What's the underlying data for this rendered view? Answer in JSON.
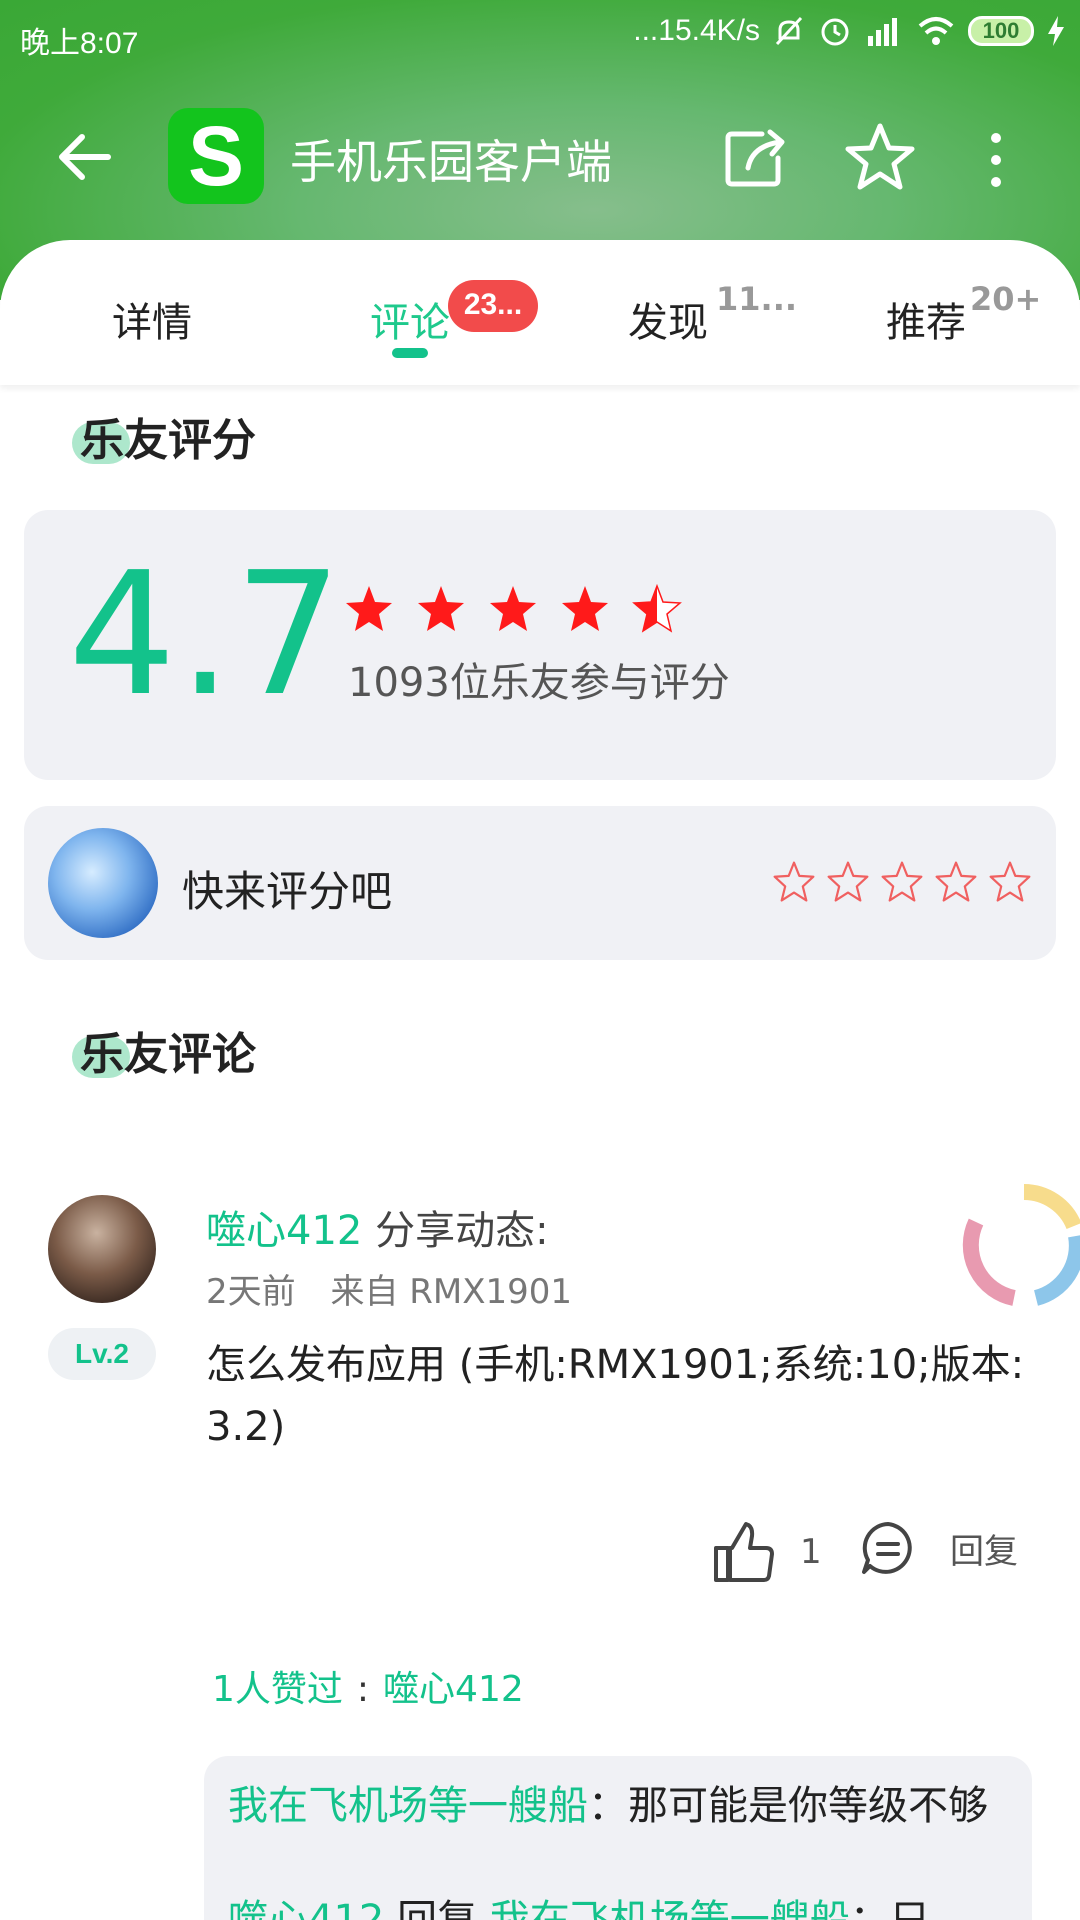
{
  "status_bar": {
    "time": "晚上8:07",
    "network_speed": "...15.4K/s",
    "battery": "100"
  },
  "toolbar": {
    "app_icon_letter": "S",
    "title": "手机乐园客户端"
  },
  "tabs": [
    {
      "label": "详情",
      "count": ""
    },
    {
      "label": "评论",
      "count": "23..."
    },
    {
      "label": "发现",
      "count": "11..."
    },
    {
      "label": "推荐",
      "count": "20+"
    }
  ],
  "rating_section": {
    "heading": "乐友评分",
    "score": "4.7",
    "stars_value": 4.5,
    "count_text": "1093位乐友参与评分"
  },
  "rate_prompt": {
    "text": "快来评分吧",
    "star_count": 5
  },
  "comments_section": {
    "heading": "乐友评论"
  },
  "comment": {
    "user": "噬心412",
    "action": "分享动态:",
    "time": "2天前",
    "source": "来自 RMX1901",
    "level": "Lv.2",
    "body": "怎么发布应用 (手机:RMX1901;系统:10;版本: 3.2)",
    "likes": "1",
    "reply_label": "回复",
    "liked_count_text": "1人赞过",
    "liked_sep": ":",
    "liked_user": "噬心412",
    "replies": [
      {
        "user": "我在飞机场等一艘船",
        "sep": "：",
        "text": "那可能是你等级不够"
      },
      {
        "user": "噬心412",
        "middle": " 回复 ",
        "target": "我在飞机场等一艘船",
        "sep": "：",
        "text": "只"
      }
    ]
  },
  "colors": {
    "accent": "#13c28b",
    "header_green": "#3faa3a",
    "badge_red": "#f24b4b",
    "star_red": "#ff1a1a"
  }
}
